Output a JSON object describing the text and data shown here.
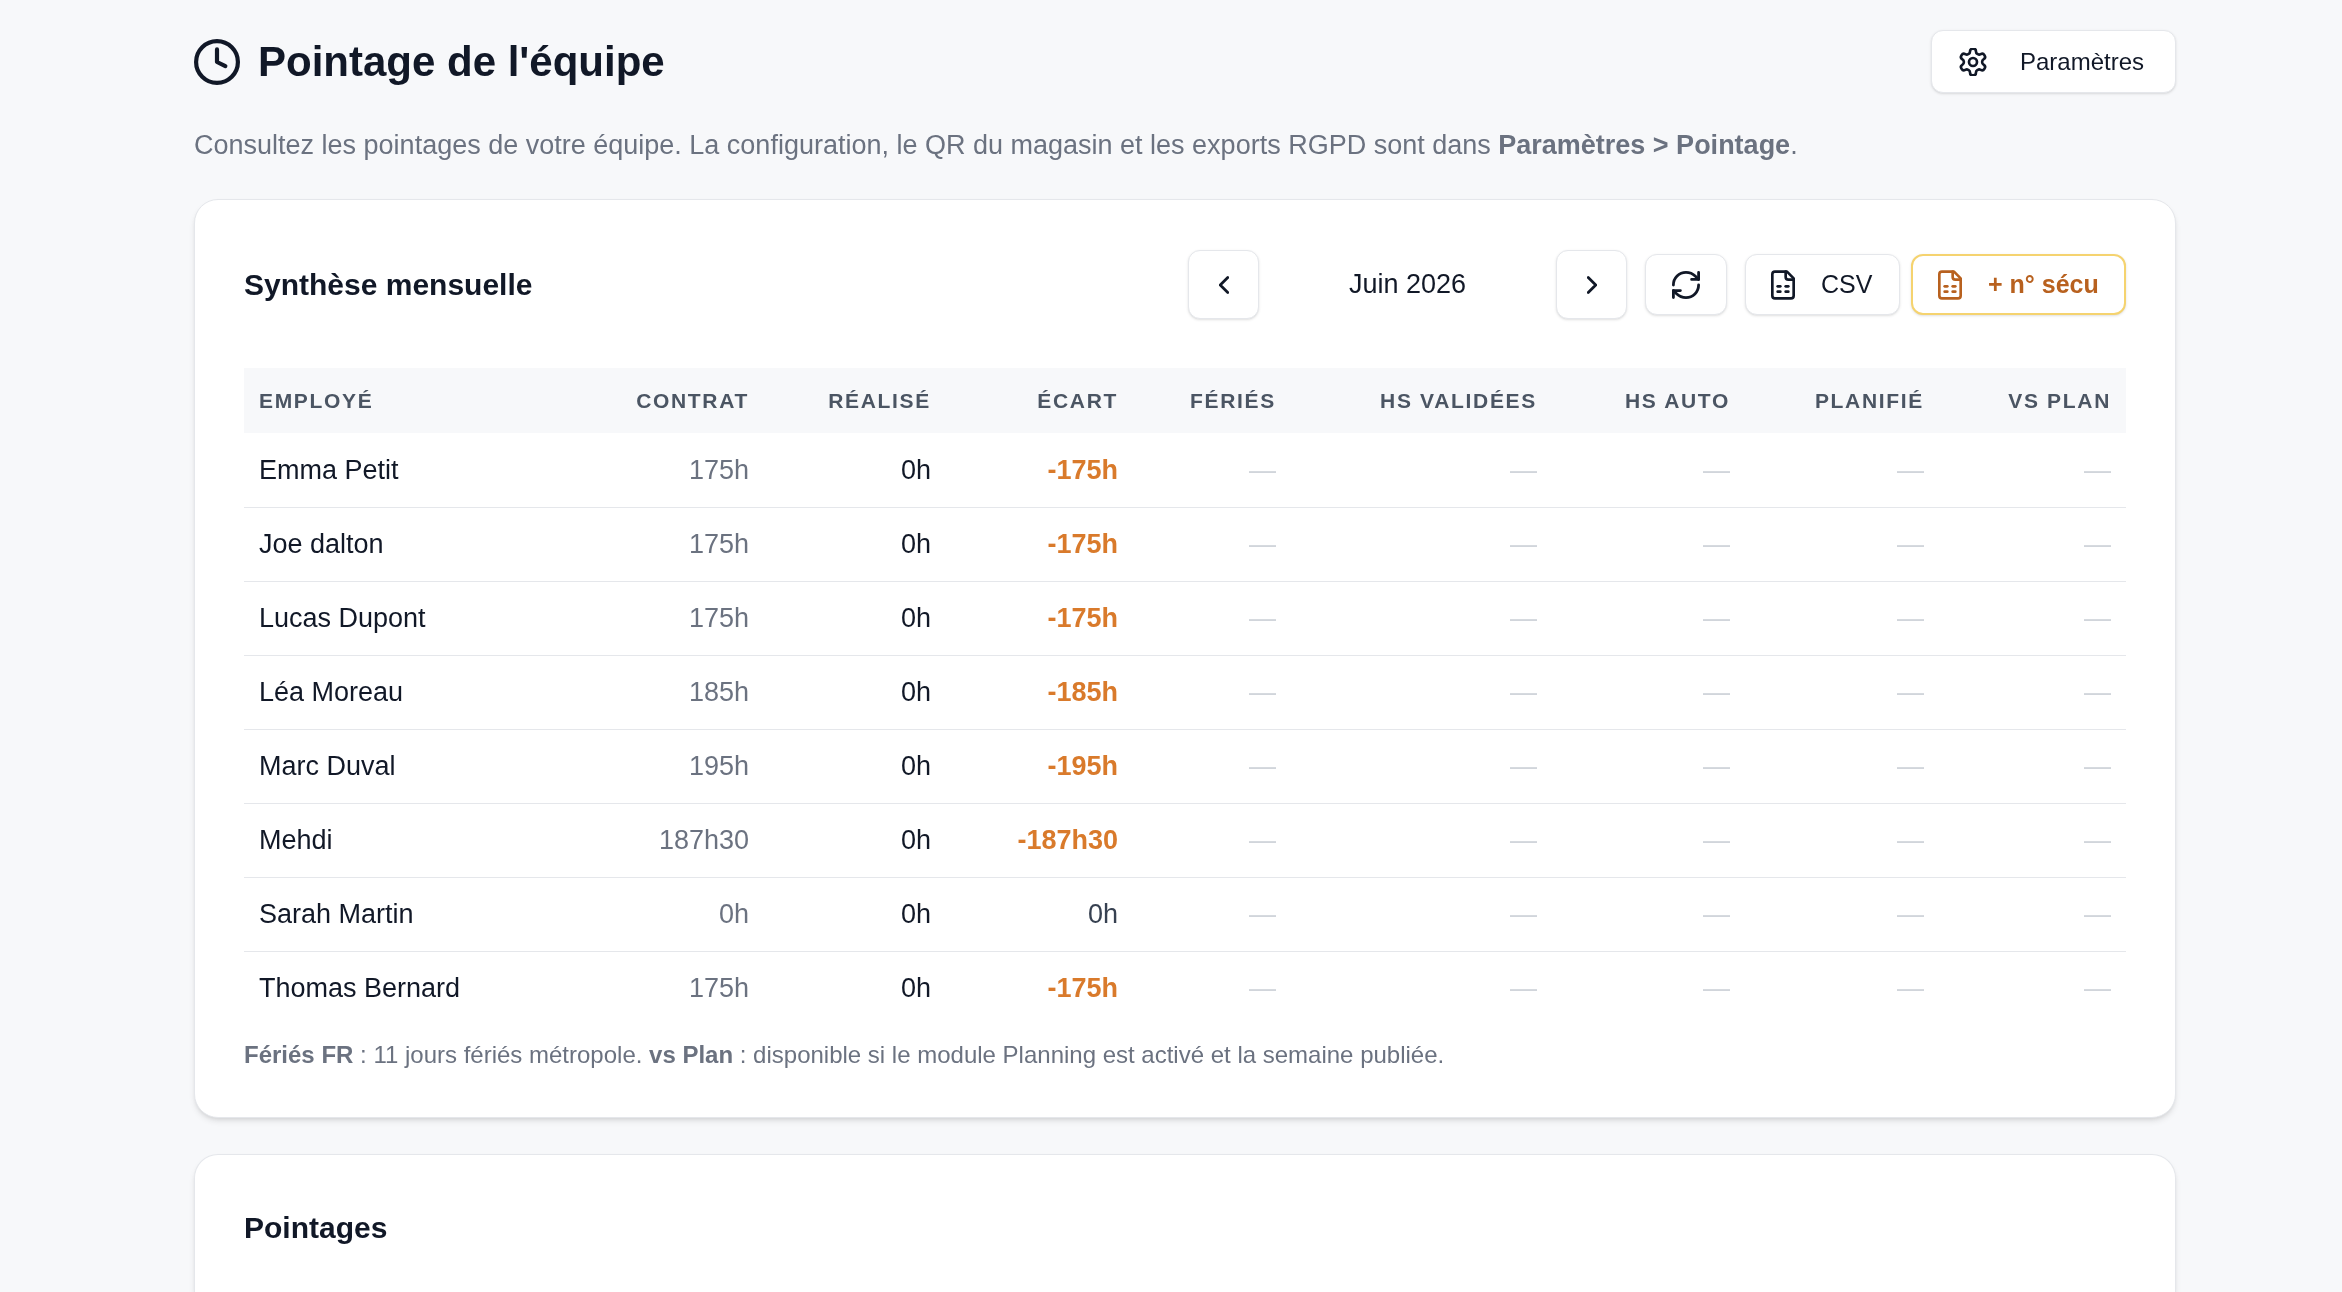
{
  "header": {
    "title": "Pointage de l'équipe",
    "settings_button": "Paramètres",
    "description": "Consultez les pointages de votre équipe. La configuration, le QR du magasin et les exports RGPD sont dans **Paramètres > Pointage**."
  },
  "summary": {
    "title": "Synthèse mensuelle",
    "month": "Juin 2026",
    "export_buttons": [
      {
        "label": "CSV",
        "kind": "default"
      },
      {
        "label": "+ n° sécu",
        "kind": "accent"
      }
    ],
    "table": {
      "columns": [
        {
          "label": "EMPLOYÉ",
          "kind": "name"
        },
        {
          "label": "CONTRAT",
          "kind": "muted"
        },
        {
          "label": "RÉALISÉ",
          "kind": "plain"
        },
        {
          "label": "ÉCART",
          "kind": "gap"
        },
        {
          "label": "FÉRIÉS",
          "kind": "placeholder"
        },
        {
          "label": "HS VALIDÉES",
          "kind": "placeholder"
        },
        {
          "label": "HS AUTO",
          "kind": "placeholder"
        },
        {
          "label": "PLANIFIÉ",
          "kind": "placeholder"
        },
        {
          "label": "VS PLAN",
          "kind": "placeholder"
        }
      ],
      "rows": [
        {
          "cells": [
            "Emma Petit",
            "175h",
            "0h",
            "-175h",
            "—",
            "—",
            "—",
            "—",
            "—"
          ],
          "negative": true
        },
        {
          "cells": [
            "Joe dalton",
            "175h",
            "0h",
            "-175h",
            "—",
            "—",
            "—",
            "—",
            "—"
          ],
          "negative": true
        },
        {
          "cells": [
            "Lucas Dupont",
            "175h",
            "0h",
            "-175h",
            "—",
            "—",
            "—",
            "—",
            "—"
          ],
          "negative": true
        },
        {
          "cells": [
            "Léa Moreau",
            "185h",
            "0h",
            "-185h",
            "—",
            "—",
            "—",
            "—",
            "—"
          ],
          "negative": true
        },
        {
          "cells": [
            "Marc Duval",
            "195h",
            "0h",
            "-195h",
            "—",
            "—",
            "—",
            "—",
            "—"
          ],
          "negative": true
        },
        {
          "cells": [
            "Mehdi",
            "187h30",
            "0h",
            "-187h30",
            "—",
            "—",
            "—",
            "—",
            "—"
          ],
          "negative": true
        },
        {
          "cells": [
            "Sarah Martin",
            "0h",
            "0h",
            "0h",
            "—",
            "—",
            "—",
            "—",
            "—"
          ],
          "negative": false
        },
        {
          "cells": [
            "Thomas Bernard",
            "175h",
            "0h",
            "-175h",
            "—",
            "—",
            "—",
            "—",
            "—"
          ],
          "negative": true
        }
      ]
    },
    "footnote": "**Fériés FR** : 11 jours fériés métropole. **vs Plan** : disponible si le module Planning est activé et la semaine publiée."
  },
  "clockings": {
    "title": "Pointages"
  }
}
